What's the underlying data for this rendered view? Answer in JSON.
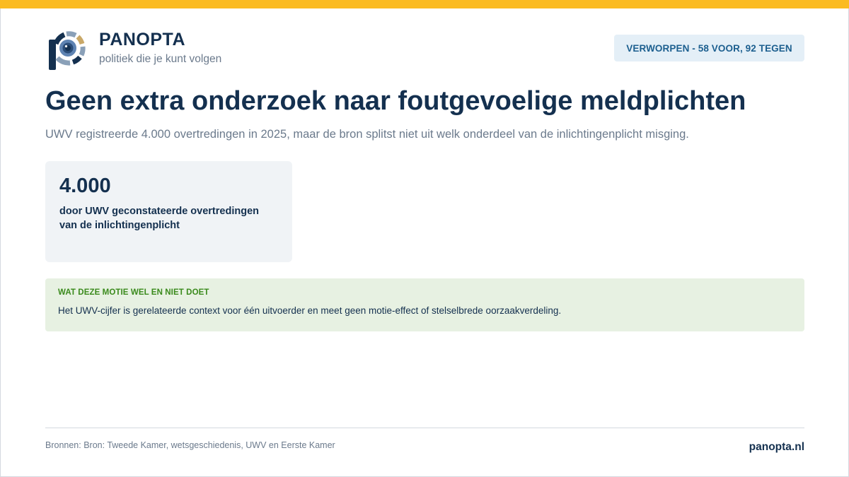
{
  "brand": {
    "name": "PANOPTA",
    "tagline": "politiek die je kunt volgen",
    "logo_icon": "panopta-eye-logo-icon",
    "accent_color": "#fbbb22",
    "primary_color": "#14304f"
  },
  "verdict": {
    "label": "VERWORPEN - 58 VOOR, 92 TEGEN",
    "votes_for": 58,
    "votes_against": 92
  },
  "title": "Geen extra onderzoek naar foutgevoelige meldplichten",
  "subtitle": "UWV registreerde 4.000 overtredingen in 2025, maar de bron splitst niet uit welk onderdeel van de inlichtingenplicht misging.",
  "stat": {
    "value": "4.000",
    "label": "door UWV geconstateerde overtredingen van de inlichtingenplicht"
  },
  "note": {
    "heading": "WAT DEZE MOTIE WEL EN NIET DOET",
    "text": "Het UWV-cijfer is gerelateerde context voor één uitvoerder en meet geen motie-effect of stelselbrede oorzaakverdeling.",
    "accent_color": "#3a8a1c"
  },
  "footer": {
    "sources": "Bronnen: Bron: Tweede Kamer, wetsgeschiedenis, UWV en Eerste Kamer",
    "site": "panopta.nl"
  }
}
